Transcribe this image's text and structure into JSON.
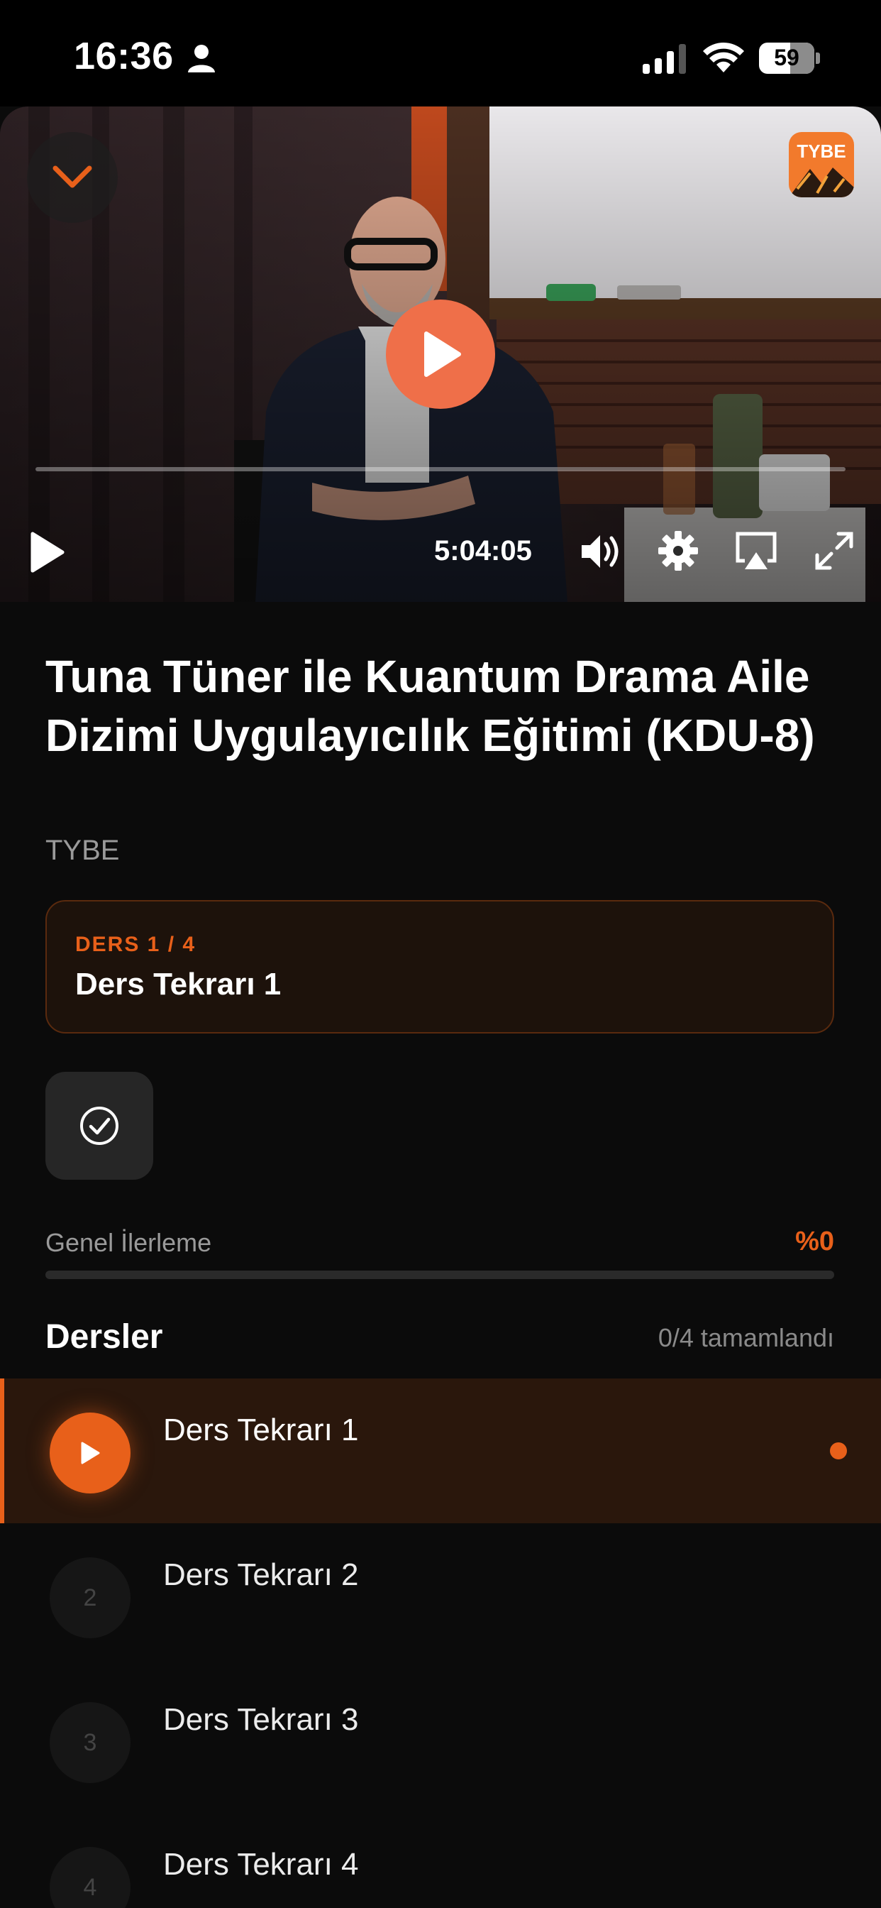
{
  "status_bar": {
    "time": "16:36",
    "battery": "59"
  },
  "player": {
    "brand_badge": "TYBE",
    "timecode": "5:04:05",
    "progress": 0
  },
  "course": {
    "title": "Tuna Tüner ile Kuantum Drama Aile Dizimi Uygulayıcılık Eğitimi (KDU-8)",
    "provider": "TYBE"
  },
  "current_lesson": {
    "kicker": "DERS 1 / 4",
    "name": "Ders Tekrarı 1"
  },
  "progress": {
    "label": "Genel İlerleme",
    "value_text": "%0",
    "fraction": 0
  },
  "lessons": {
    "heading": "Dersler",
    "completed_text": "0/4 tamamlandı",
    "items": [
      {
        "number": "",
        "label": "Ders Tekrarı 1"
      },
      {
        "number": "2",
        "label": "Ders Tekrarı 2"
      },
      {
        "number": "3",
        "label": "Ders Tekrarı 3"
      },
      {
        "number": "4",
        "label": "Ders Tekrarı 4"
      }
    ]
  },
  "colors": {
    "accent": "#e8601a",
    "background": "#0b0b0b",
    "play_button": "#ef6f49"
  }
}
